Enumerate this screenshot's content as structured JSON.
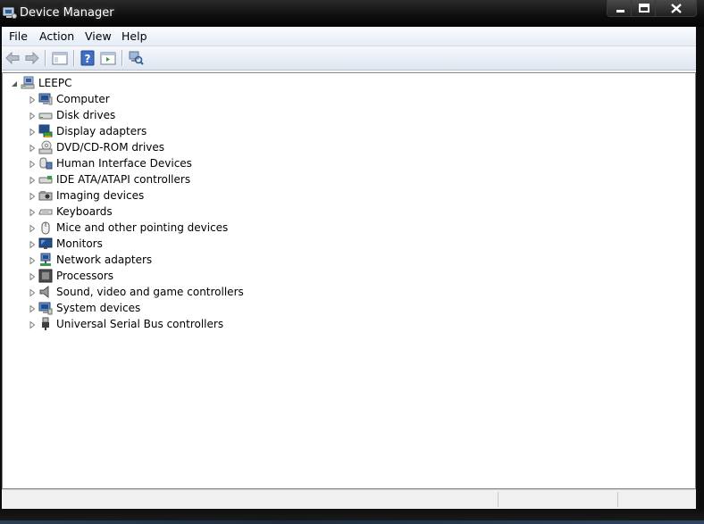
{
  "window": {
    "title": "Device Manager",
    "icon": "device-manager-icon"
  },
  "menu": [
    "File",
    "Action",
    "View",
    "Help"
  ],
  "toolbar": {
    "buttons": [
      "back-arrow-icon",
      "forward-arrow-icon",
      "show-hide-console-tree-icon",
      "help-icon",
      "properties-icon",
      "scan-hardware-icon"
    ]
  },
  "tree": {
    "root": {
      "label": "LEEPC",
      "icon": "computer-network-icon"
    },
    "categories": [
      {
        "label": "Computer",
        "icon": "computer-icon"
      },
      {
        "label": "Disk drives",
        "icon": "disk-drive-icon"
      },
      {
        "label": "Display adapters",
        "icon": "display-adapter-icon"
      },
      {
        "label": "DVD/CD-ROM drives",
        "icon": "dvd-drive-icon"
      },
      {
        "label": "Human Interface Devices",
        "icon": "hid-icon"
      },
      {
        "label": "IDE ATA/ATAPI controllers",
        "icon": "ide-controller-icon"
      },
      {
        "label": "Imaging devices",
        "icon": "imaging-device-icon"
      },
      {
        "label": "Keyboards",
        "icon": "keyboard-icon"
      },
      {
        "label": "Mice and other pointing devices",
        "icon": "mouse-icon"
      },
      {
        "label": "Monitors",
        "icon": "monitor-icon"
      },
      {
        "label": "Network adapters",
        "icon": "network-adapter-icon"
      },
      {
        "label": "Processors",
        "icon": "processor-icon"
      },
      {
        "label": "Sound, video and game controllers",
        "icon": "sound-icon"
      },
      {
        "label": "System devices",
        "icon": "system-devices-icon"
      },
      {
        "label": "Universal Serial Bus controllers",
        "icon": "usb-icon"
      }
    ]
  },
  "colors": {
    "title_bar": "#0d0d0d",
    "close_button": "#c4463b",
    "tree_background": "#ffffff"
  }
}
